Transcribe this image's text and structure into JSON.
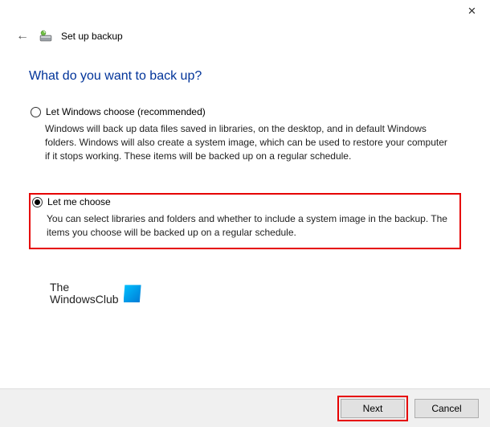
{
  "window": {
    "title": "Set up backup",
    "close_icon": "close-icon"
  },
  "heading": "What do you want to back up?",
  "options": {
    "auto": {
      "label": "Let Windows choose (recommended)",
      "desc": "Windows will back up data files saved in libraries, on the desktop, and in default Windows folders. Windows will also create a system image, which can be used to restore your computer if it stops working. These items will be backed up on a regular schedule.",
      "selected": false
    },
    "manual": {
      "label": "Let me choose",
      "desc": "You can select libraries and folders and whether to include a system image in the backup. The items you choose will be backed up on a regular schedule.",
      "selected": true
    }
  },
  "watermark": {
    "line1": "The",
    "line2": "WindowsClub"
  },
  "buttons": {
    "next": "Next",
    "cancel": "Cancel"
  }
}
